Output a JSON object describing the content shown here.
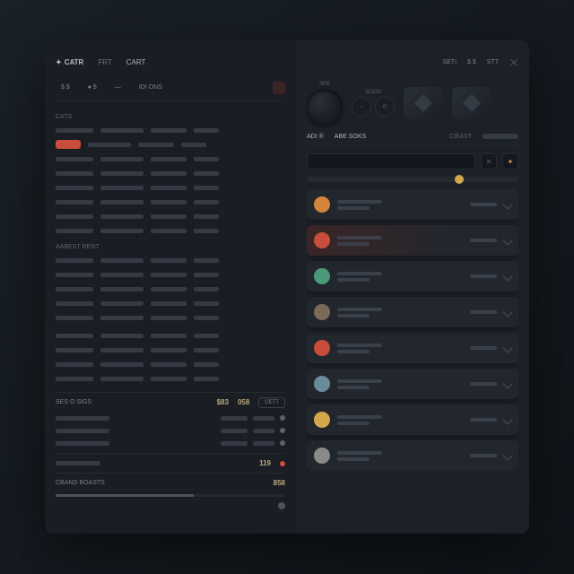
{
  "header": {
    "brand": "CATR",
    "tabs": [
      "FRT",
      "CART"
    ],
    "right": [
      "SETI",
      "$ $",
      "STT"
    ]
  },
  "filters": {
    "f1": "$ $",
    "f2": "● $",
    "f3": "—",
    "f4": "IDI ONS"
  },
  "left": {
    "hdr1": "CATS",
    "rows1": 8,
    "hdr2": "AABEST RENT",
    "rows2": 5,
    "rows3": 4,
    "sum1_lbl": "SES O SIGS",
    "sum1_val": "$83",
    "sum1_val2": "058",
    "sum1_btn": "CETT",
    "detail_rows": 3,
    "sum2_val": "119",
    "sum3_lbl": "CBAND BOASTS",
    "sum3_val": "858",
    "progress": 0.6
  },
  "right": {
    "knob_labels": [
      "SPE",
      "SCEDI"
    ],
    "tabs": {
      "t1": "ADI ®",
      "t2": "ABE SOKS",
      "t3": "CIEAST"
    },
    "slider_pos": 0.7,
    "cards": [
      {
        "color": "#d4843a",
        "hl": false
      },
      {
        "color": "#c94d3a",
        "hl": true
      },
      {
        "color": "#4a9a7a",
        "hl": false
      },
      {
        "color": "#7a6a5a",
        "hl": false
      },
      {
        "color": "#c94d3a",
        "hl": false
      },
      {
        "color": "#6a8a9a",
        "hl": false
      },
      {
        "color": "#d4a84a",
        "hl": false
      },
      {
        "color": "#8a8a8a",
        "hl": false
      }
    ]
  }
}
